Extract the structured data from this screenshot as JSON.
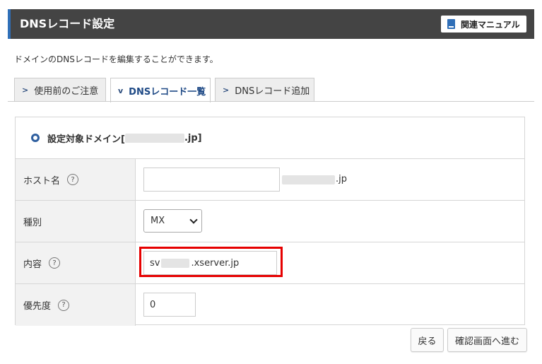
{
  "header": {
    "title": "DNSレコード設定",
    "manual_label": "関連マニュアル"
  },
  "description": "ドメインのDNSレコードを編集することができます。",
  "tabs": [
    {
      "label": "使用前のご注意",
      "active": false
    },
    {
      "label": "DNSレコード一覧",
      "active": true
    },
    {
      "label": "DNSレコード追加",
      "active": false
    }
  ],
  "domain": {
    "prefix": "設定対象ドメイン[",
    "suffix": ".jp]"
  },
  "form": {
    "host": {
      "label": "ホスト名",
      "value": "",
      "domain_suffix": ".jp"
    },
    "type": {
      "label": "種別",
      "selected": "MX"
    },
    "content": {
      "label": "内容",
      "prefix": "sv",
      "suffix": ".xserver.jp"
    },
    "priority": {
      "label": "優先度",
      "value": "0"
    }
  },
  "buttons": {
    "back": "戻る",
    "confirm": "確認画面へ進む"
  },
  "help_glyph": "?",
  "colors": {
    "accent": "#2f6fb8",
    "header_bg": "#444444",
    "highlight": "#e60000"
  }
}
